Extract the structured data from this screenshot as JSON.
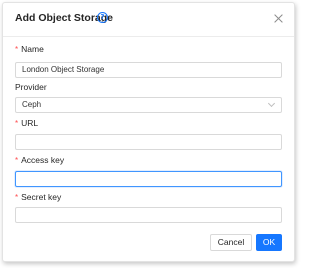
{
  "dialog": {
    "title": "Add Object Storage",
    "help_icon": "question-circle-icon",
    "close_icon": "close-icon"
  },
  "form": {
    "name": {
      "label": "Name",
      "required": true,
      "value": "London Object Storage"
    },
    "provider": {
      "label": "Provider",
      "required": false,
      "value": "Ceph",
      "icon": "chevron-down-icon"
    },
    "url": {
      "label": "URL",
      "required": true,
      "value": ""
    },
    "access_key": {
      "label": "Access key",
      "required": true,
      "value": "",
      "focused": true
    },
    "secret_key": {
      "label": "Secret key",
      "required": true,
      "value": ""
    }
  },
  "footer": {
    "cancel_label": "Cancel",
    "ok_label": "OK"
  },
  "colors": {
    "primary": "#1677ff",
    "required": "#ff4d4f",
    "border": "#d9d9d9"
  }
}
